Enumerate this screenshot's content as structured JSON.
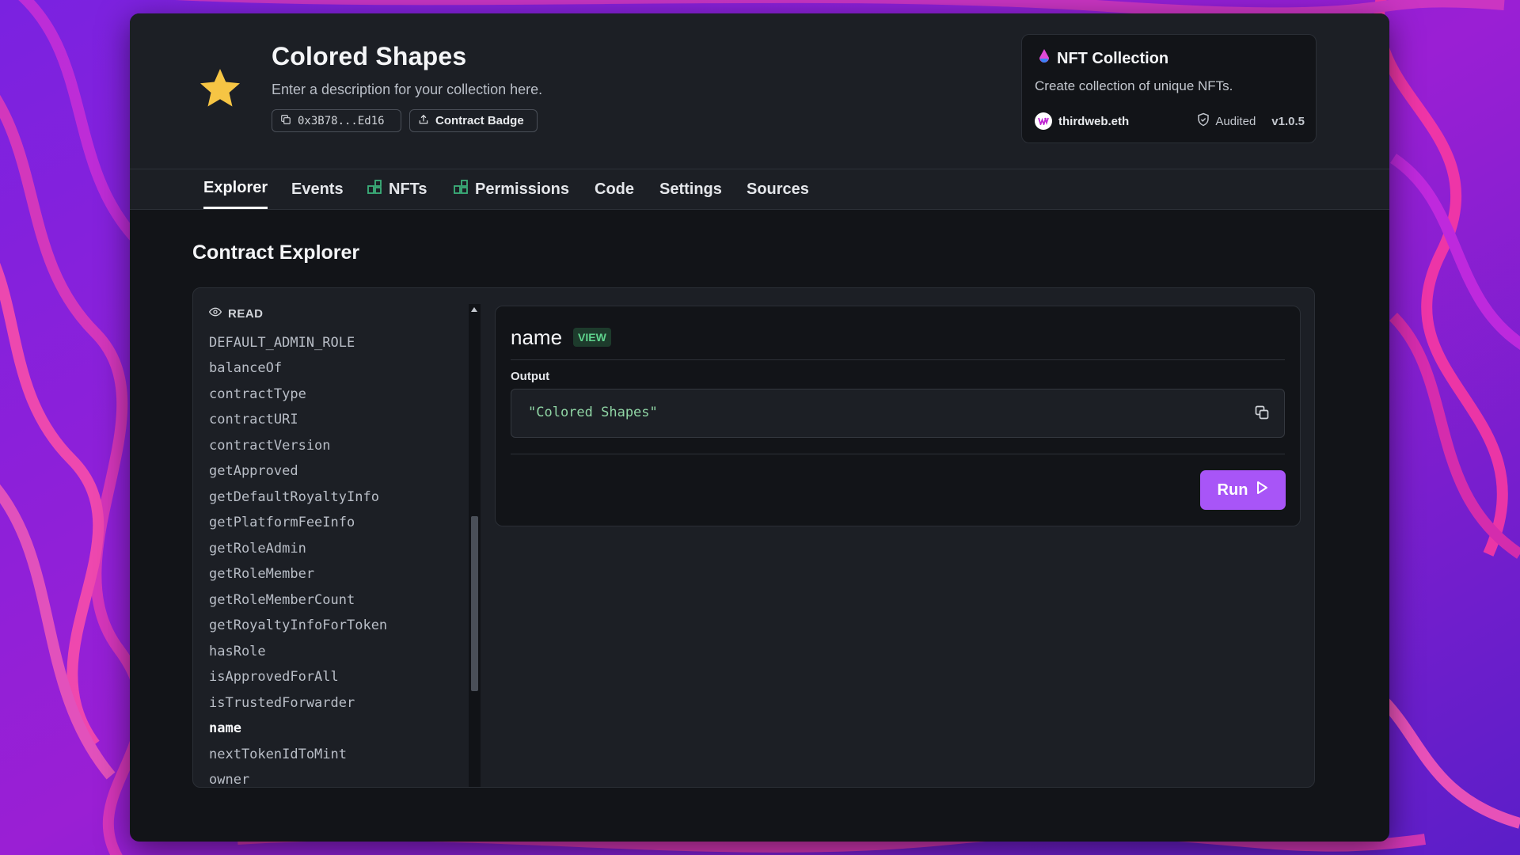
{
  "collection": {
    "title": "Colored Shapes",
    "description": "Enter a description for your collection here.",
    "address": "0x3B78...Ed16",
    "badge_label": "Contract Badge"
  },
  "contract_card": {
    "title": "NFT Collection",
    "description": "Create collection of unique NFTs.",
    "publisher": "thirdweb.eth",
    "audited_label": "Audited",
    "version": "v1.0.5"
  },
  "tabs": [
    {
      "label": "Explorer",
      "active": true
    },
    {
      "label": "Events"
    },
    {
      "label": "NFTs",
      "icon": "grid-icon"
    },
    {
      "label": "Permissions",
      "icon": "grid-icon"
    },
    {
      "label": "Code"
    },
    {
      "label": "Settings"
    },
    {
      "label": "Sources"
    }
  ],
  "section_title": "Contract Explorer",
  "function_list": {
    "header": "READ",
    "items": [
      "DEFAULT_ADMIN_ROLE",
      "balanceOf",
      "contractType",
      "contractURI",
      "contractVersion",
      "getApproved",
      "getDefaultRoyaltyInfo",
      "getPlatformFeeInfo",
      "getRoleAdmin",
      "getRoleMember",
      "getRoleMemberCount",
      "getRoyaltyInfoForToken",
      "hasRole",
      "isApprovedForAll",
      "isTrustedForwarder",
      "name",
      "nextTokenIdToMint",
      "owner"
    ],
    "selected": "name"
  },
  "detail": {
    "function_name": "name",
    "badge": "VIEW",
    "output_label": "Output",
    "output_value": "\"Colored Shapes\"",
    "run_label": "Run"
  },
  "colors": {
    "accent": "#a855f7",
    "star": "#f6c544",
    "view_badge": "#5fd38d",
    "nft_tab_icon": "#3bb07a"
  }
}
